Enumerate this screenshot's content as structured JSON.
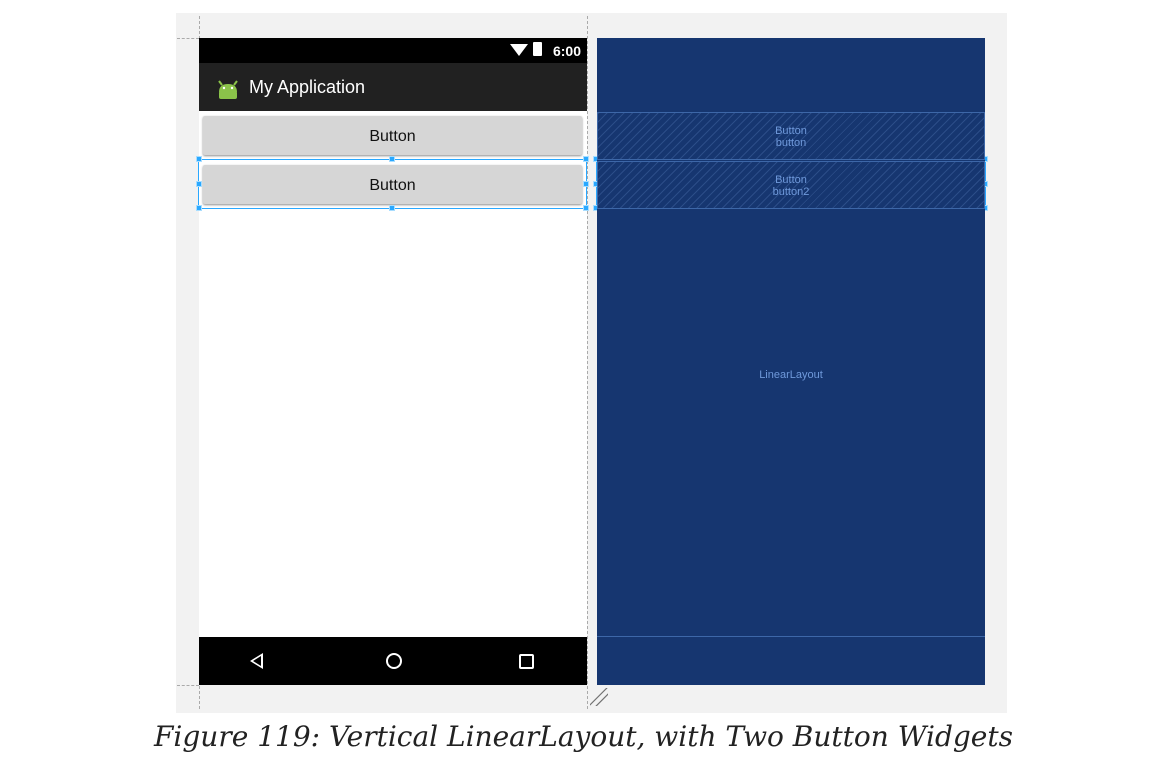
{
  "device": {
    "status_time": "6:00",
    "app_title": "My Application"
  },
  "preview": {
    "buttons": [
      {
        "label": "Button"
      },
      {
        "label": "Button"
      }
    ]
  },
  "blueprint": {
    "widgets": [
      {
        "type": "Button",
        "id": "button"
      },
      {
        "type": "Button",
        "id": "button2"
      }
    ],
    "container_label": "LinearLayout"
  },
  "caption": {
    "text": "Figure 119: Vertical LinearLayout, with Two Button Widgets"
  },
  "icons": {
    "status": [
      "wifi-icon",
      "battery-icon"
    ],
    "app": "android-icon",
    "navigation": [
      "back-icon",
      "home-icon",
      "recent-apps-icon"
    ],
    "resize": "resize-grip-icon"
  },
  "colors": {
    "selection": "#2aa8ff",
    "blueprint_background": "#163670",
    "blueprint_text": "#6f99db",
    "android_green": "#8bc34a"
  }
}
